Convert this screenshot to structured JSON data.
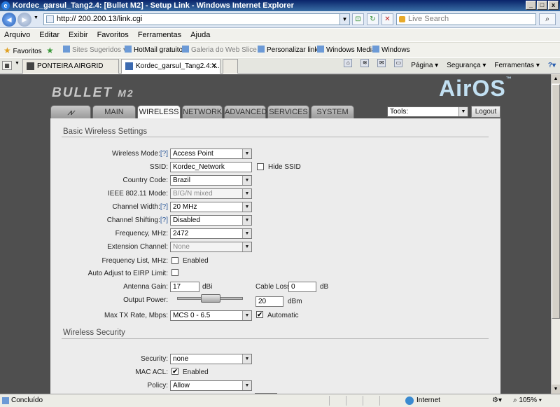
{
  "window": {
    "title": "Kordec_garsul_Tang2.4: [Bullet M2] - Setup Link - Windows Internet Explorer",
    "btn_min": "_",
    "btn_max": "□",
    "btn_close": "x"
  },
  "address": {
    "url": "http://          200.200.13/link.cgi",
    "search_placeholder": "Live Search"
  },
  "menu": [
    "Arquivo",
    "Editar",
    "Exibir",
    "Favoritos",
    "Ferramentas",
    "Ajuda"
  ],
  "favorites": {
    "label": "Favoritos",
    "items": [
      "Sites Sugeridos ▾",
      "HotMail gratuito",
      "Galeria do Web Slice ▾",
      "Personalizar links",
      "Windows Media",
      "Windows"
    ]
  },
  "tabs": [
    {
      "label": "PONTEIRA AIRGRID"
    },
    {
      "label": "Kordec_garsul_Tang2.4: ..."
    }
  ],
  "commands": [
    "Página ▾",
    "Segurança ▾",
    "Ferramentas ▾"
  ],
  "app": {
    "brand": "BULLET",
    "model": "M2",
    "os": "AirOS",
    "os_tm": "™",
    "nav": [
      "MAIN",
      "WIRELESS",
      "NETWORK",
      "ADVANCED",
      "SERVICES",
      "SYSTEM"
    ],
    "tools_value": "Tools:",
    "logout": "Logout"
  },
  "basic": {
    "heading": "Basic Wireless Settings",
    "wireless_mode_label": "Wireless Mode:",
    "help": "[?]",
    "wireless_mode": "Access Point",
    "ssid_label": "SSID:",
    "ssid": "Kordec_Network",
    "hide_ssid": "Hide SSID",
    "country_label": "Country Code:",
    "country": "Brazil",
    "ieee_label": "IEEE 802.11 Mode:",
    "ieee": "B/G/N mixed",
    "channel_width_label": "Channel Width:",
    "channel_width": "20 MHz",
    "channel_shifting_label": "Channel Shifting:",
    "channel_shifting": "Disabled",
    "frequency_label": "Frequency, MHz:",
    "frequency": "2472",
    "ext_channel_label": "Extension Channel:",
    "ext_channel": "None",
    "freq_list_label": "Frequency List, MHz:",
    "enabled": "Enabled",
    "auto_adjust_label": "Auto Adjust to EIRP Limit:",
    "antenna_gain_label": "Antenna Gain:",
    "antenna_gain": "17",
    "dbi": "dBi",
    "cable_loss_label": "Cable Loss:",
    "cable_loss": "0",
    "db": "dB",
    "output_power_label": "Output Power:",
    "output_power": "20",
    "dbm": "dBm",
    "max_tx_label": "Max TX Rate, Mbps:",
    "max_tx": "MCS 0 - 6.5",
    "automatic": "Automatic",
    "check": "✔"
  },
  "security": {
    "heading": "Wireless Security",
    "security_label": "Security:",
    "security": "none",
    "mac_acl_label": "MAC ACL:",
    "enabled": "Enabled",
    "policy_label": "Policy:",
    "policy": "Allow"
  },
  "status": {
    "text": "Concluído",
    "zone": "Internet",
    "zoom": "105%"
  }
}
